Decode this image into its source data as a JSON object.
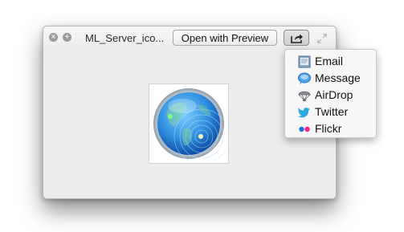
{
  "window": {
    "title": "ML_Server_ico...",
    "open_with_label": "Open with Preview"
  },
  "share_menu": {
    "items": [
      {
        "label": "Email",
        "icon": "mail-icon"
      },
      {
        "label": "Message",
        "icon": "message-icon"
      },
      {
        "label": "AirDrop",
        "icon": "airdrop-icon"
      },
      {
        "label": "Twitter",
        "icon": "twitter-icon"
      },
      {
        "label": "Flickr",
        "icon": "flickr-icon"
      }
    ]
  },
  "colors": {
    "globe_blue": "#2f8fe0",
    "twitter_blue": "#2aa9e0",
    "flickr_blue": "#1e6fd8",
    "flickr_pink": "#ff1f8f"
  }
}
